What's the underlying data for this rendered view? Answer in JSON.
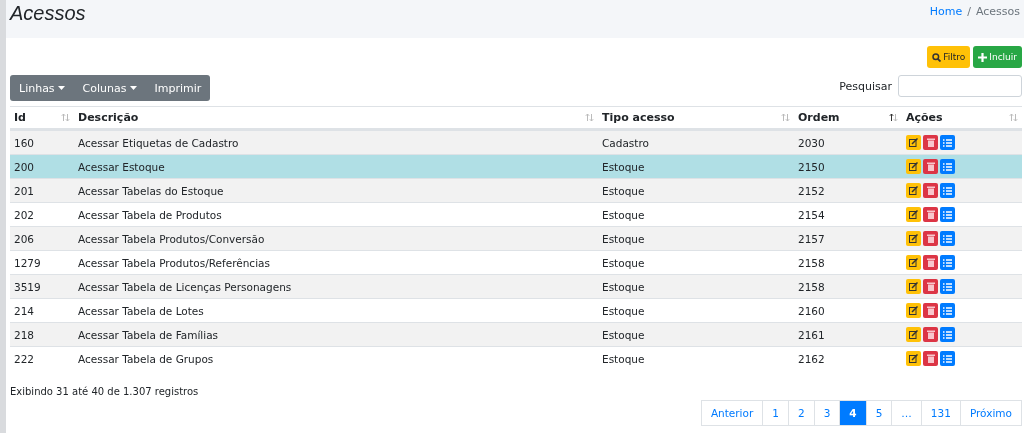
{
  "page_title": "Acessos",
  "breadcrumb": [
    {
      "label": "Home",
      "link": true
    },
    {
      "label": "Acessos",
      "link": false
    }
  ],
  "breadcrumb_separator": "/",
  "actions": [
    {
      "label": "Filtro",
      "kind": "filter"
    },
    {
      "label": "Incluir",
      "kind": "add"
    }
  ],
  "toolbar": [
    {
      "label": "Linhas",
      "dropdown": true
    },
    {
      "label": "Colunas",
      "dropdown": true
    },
    {
      "label": "Imprimir",
      "dropdown": false
    }
  ],
  "search": {
    "label": "Pesquisar"
  },
  "table": {
    "columns": [
      {
        "label": "Id",
        "sorted": false
      },
      {
        "label": "Descrição",
        "sorted": false
      },
      {
        "label": "Tipo acesso",
        "sorted": false
      },
      {
        "label": "Ordem",
        "sorted": true
      },
      {
        "label": "Ações",
        "sorted": false
      }
    ],
    "rows": [
      {
        "id": "160",
        "descricao": "Acessar Etiquetas de Cadastro",
        "tipo": "Cadastro",
        "ordem": "2030",
        "selected": false
      },
      {
        "id": "200",
        "descricao": "Acessar Estoque",
        "tipo": "Estoque",
        "ordem": "2150",
        "selected": true
      },
      {
        "id": "201",
        "descricao": "Acessar Tabelas do Estoque",
        "tipo": "Estoque",
        "ordem": "2152",
        "selected": false
      },
      {
        "id": "202",
        "descricao": "Acessar Tabela de Produtos",
        "tipo": "Estoque",
        "ordem": "2154",
        "selected": false
      },
      {
        "id": "206",
        "descricao": "Acessar Tabela Produtos/Conversão",
        "tipo": "Estoque",
        "ordem": "2157",
        "selected": false
      },
      {
        "id": "1279",
        "descricao": "Acessar Tabela Produtos/Referências",
        "tipo": "Estoque",
        "ordem": "2158",
        "selected": false
      },
      {
        "id": "3519",
        "descricao": "Acessar Tabela de Licenças Personagens",
        "tipo": "Estoque",
        "ordem": "2158",
        "selected": false
      },
      {
        "id": "214",
        "descricao": "Acessar Tabela de Lotes",
        "tipo": "Estoque",
        "ordem": "2160",
        "selected": false
      },
      {
        "id": "218",
        "descricao": "Acessar Tabela de Famílias",
        "tipo": "Estoque",
        "ordem": "2161",
        "selected": false
      },
      {
        "id": "222",
        "descricao": "Acessar Tabela de Grupos",
        "tipo": "Estoque",
        "ordem": "2162",
        "selected": false
      }
    ]
  },
  "info": "Exibindo 31 até 40 de 1.307 registros",
  "pagination": [
    {
      "label": "Anterior",
      "selected": false
    },
    {
      "label": "1",
      "selected": false
    },
    {
      "label": "2",
      "selected": false
    },
    {
      "label": "3",
      "selected": false
    },
    {
      "label": "4",
      "selected": true
    },
    {
      "label": "5",
      "selected": false
    },
    {
      "label": "…",
      "selected": false
    },
    {
      "label": "131",
      "selected": false
    },
    {
      "label": "Próximo",
      "selected": false
    }
  ]
}
